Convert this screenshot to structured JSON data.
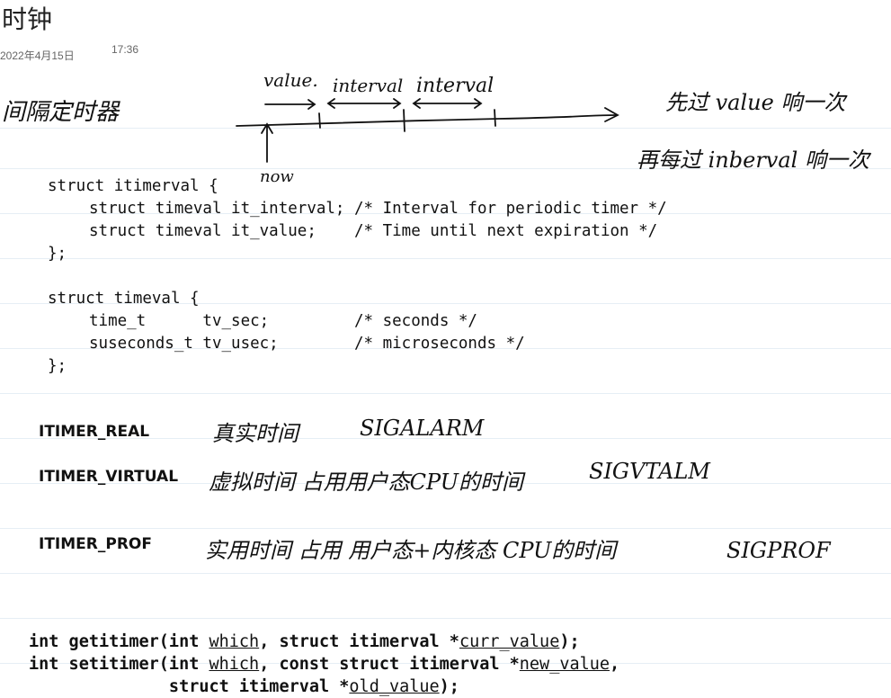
{
  "page": {
    "title": "时钟",
    "date": "2022年4月15日",
    "time": "17:36"
  },
  "notes": {
    "interval_timer": "间隔定时器",
    "value_label": "value.",
    "interval_label_1": "interval",
    "interval_label_2": "interval",
    "now_label": "now",
    "first_value": "先过 value 响一次",
    "then_interval": "再每过 inberval 响一次"
  },
  "code": {
    "itimerval_open": "struct itimerval {",
    "it_interval": "struct timeval it_interval; /* Interval for periodic timer */",
    "it_value": "struct timeval it_value;    /* Time until next expiration */",
    "itimerval_close": "};",
    "timeval_open": "struct timeval {",
    "tv_sec": "time_t      tv_sec;         /* seconds */",
    "tv_usec": "suseconds_t tv_usec;        /* microseconds */",
    "timeval_close": "};"
  },
  "timers": [
    {
      "name": "ITIMER_REAL",
      "note": "真实时间",
      "signal": "SIGALARM"
    },
    {
      "name": "ITIMER_VIRTUAL",
      "note": "虚拟时间  占用用户态CPU的时间",
      "signal": "SIGVTALM"
    },
    {
      "name": "ITIMER_PROF",
      "note": "实用时间  占用  用户态+内核态 CPU的时间",
      "signal": "SIGPROF"
    }
  ],
  "prototypes": {
    "get_prefix": "int getitimer(int ",
    "get_which": "which",
    "get_mid": ", struct itimerval *",
    "get_param": "curr_value",
    "get_suffix": ");",
    "set_prefix": "int setitimer(int ",
    "set_which": "which",
    "set_mid": ", const struct itimerval *",
    "set_param": "new_value",
    "set_suffix": ",",
    "set2_prefix": "              struct itimerval *",
    "set2_param": "old_value",
    "set2_suffix": ");"
  }
}
